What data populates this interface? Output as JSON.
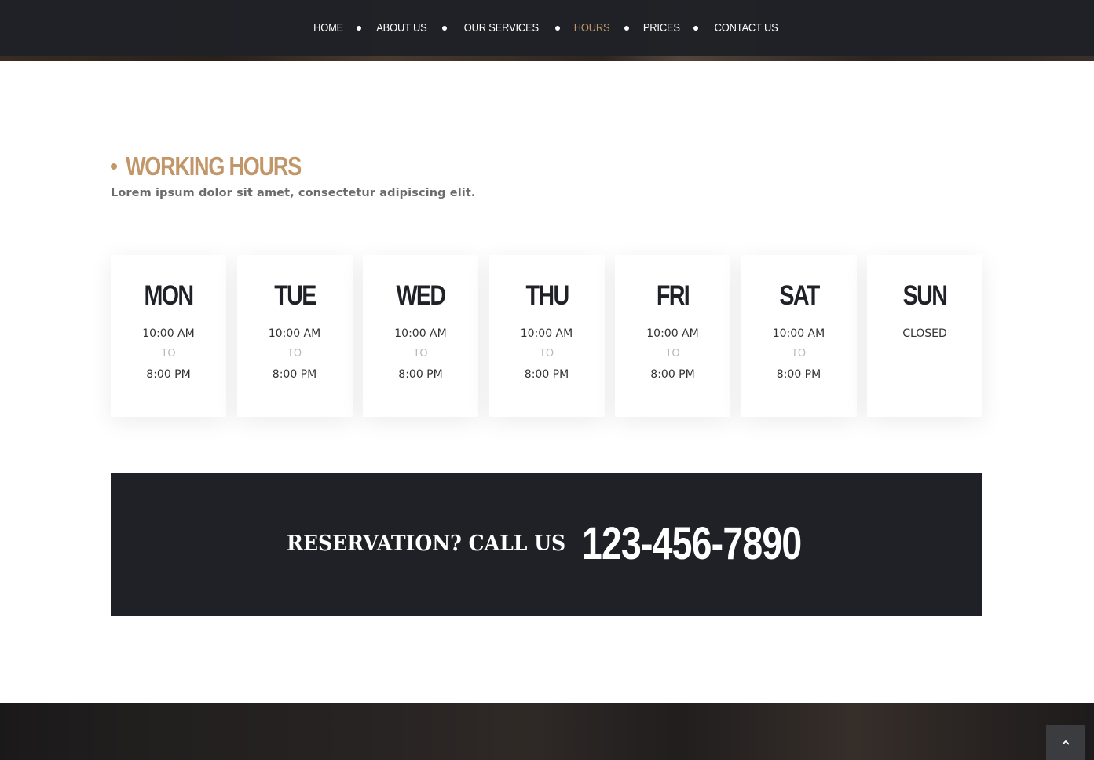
{
  "nav": {
    "items": [
      {
        "label": "HOME",
        "active": false
      },
      {
        "label": "ABOUT US",
        "active": false
      },
      {
        "label": "OUR SERVICES",
        "active": false
      },
      {
        "label": "HOURS",
        "active": true
      },
      {
        "label": "PRICES",
        "active": false
      },
      {
        "label": "CONTACT US",
        "active": false
      }
    ]
  },
  "hours": {
    "title": "WORKING HOURS",
    "subtitle": "Lorem ipsum dolor sit amet, consectetur adipiscing elit.",
    "days": [
      {
        "day": "MON",
        "open": "10:00 AM",
        "to": "TO",
        "close": "8:00 PM"
      },
      {
        "day": "TUE",
        "open": "10:00 AM",
        "to": "TO",
        "close": "8:00 PM"
      },
      {
        "day": "WED",
        "open": "10:00 AM",
        "to": "TO",
        "close": "8:00 PM"
      },
      {
        "day": "THU",
        "open": "10:00 AM",
        "to": "TO",
        "close": "8:00 PM"
      },
      {
        "day": "FRI",
        "open": "10:00 AM",
        "to": "TO",
        "close": "8:00 PM"
      },
      {
        "day": "SAT",
        "open": "10:00 AM",
        "to": "TO",
        "close": "8:00 PM"
      },
      {
        "day": "SUN",
        "open": "CLOSED",
        "to": "",
        "close": ""
      }
    ]
  },
  "reservation": {
    "label": "RESERVATION? CALL US",
    "phone": "123-456-7890"
  },
  "back_to_top": {
    "icon": "chevron-up-icon"
  },
  "colors": {
    "accent": "#c1976a",
    "dark": "#1f2126",
    "nav_bg": "#1f2126"
  }
}
